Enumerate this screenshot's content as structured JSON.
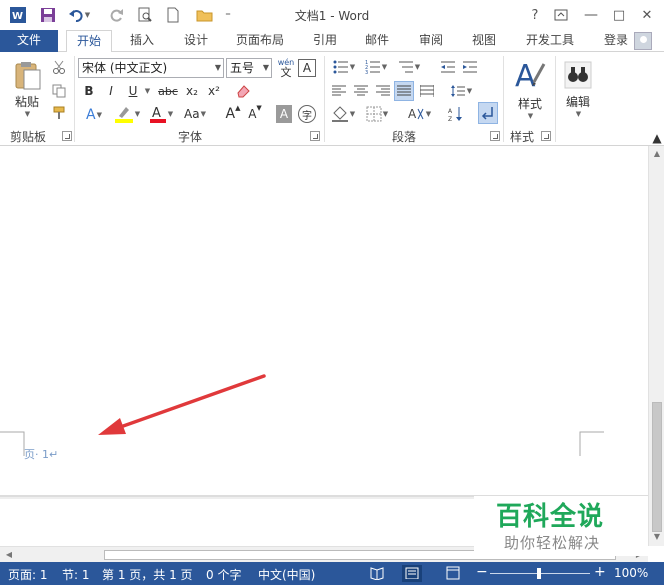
{
  "window": {
    "title": "文档1 - Word",
    "help": "?",
    "restore_ribbon": "□",
    "minimize": "—",
    "maximize": "□",
    "close": "✕"
  },
  "quick_access": {
    "customize": "⁼"
  },
  "tabs": [
    {
      "label": "文件"
    },
    {
      "label": "开始"
    },
    {
      "label": "插入"
    },
    {
      "label": "设计"
    },
    {
      "label": "页面布局"
    },
    {
      "label": "引用"
    },
    {
      "label": "邮件"
    },
    {
      "label": "审阅"
    },
    {
      "label": "视图"
    },
    {
      "label": "开发工具"
    }
  ],
  "account": {
    "login": "登录"
  },
  "ribbon": {
    "clipboard": {
      "paste": "粘贴",
      "group": "剪贴板"
    },
    "font": {
      "family": "宋体 (中文正文)",
      "size": "五号",
      "phonetic_top": "wén",
      "phonetic_bottom": "文",
      "border_char": "A",
      "bold": "B",
      "italic": "I",
      "underline": "U",
      "strike": "abc",
      "subscript": "x₂",
      "superscript": "x²",
      "grow": "A",
      "shrink": "A",
      "case": "Aa",
      "shade_char": "A",
      "enclose_char": "字",
      "group": "字体"
    },
    "paragraph": {
      "group": "段落"
    },
    "styles": {
      "label": "样式",
      "group": "样式"
    },
    "editing": {
      "label": "编辑"
    }
  },
  "document": {
    "page_number": "页· 1",
    "para_mark": "↵"
  },
  "statusbar": {
    "page": "页面: 1",
    "section": "节: 1",
    "pages": "第 1 页，共 1 页",
    "words": "0 个字",
    "language": "中文(中国)",
    "zoom": "100%"
  },
  "watermark": {
    "brand": "百科全说",
    "tagline": "助你轻松解决"
  },
  "colors": {
    "accent": "#2b579a",
    "arrow": "#e0393b",
    "highlight": "#ffff00",
    "font_color": "#e81123",
    "watermark_green": "#1fa85a"
  }
}
